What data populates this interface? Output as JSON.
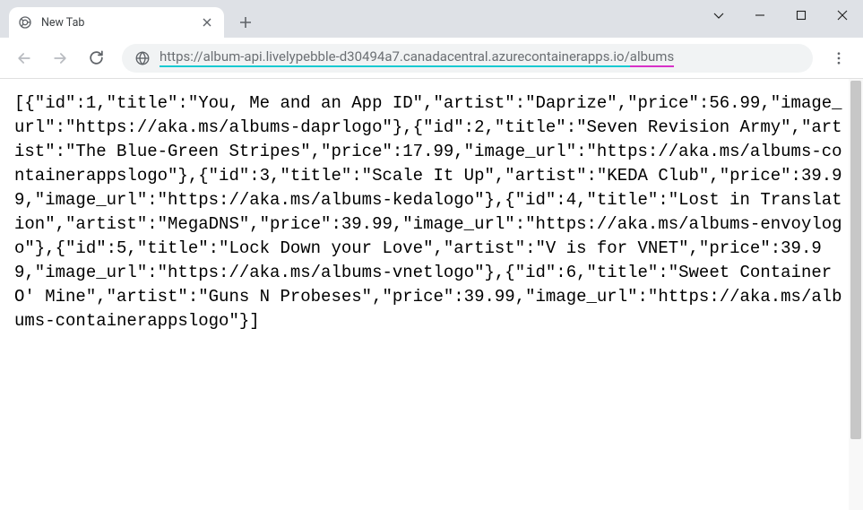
{
  "window": {
    "tab_title": "New Tab"
  },
  "toolbar": {
    "url_main": "https://album-api.livelypebble-d30494a7.canadacentral.azurecontainerapps.io/",
    "url_path": "albums"
  },
  "body_text": "[{\"id\":1,\"title\":\"You, Me and an App ID\",\"artist\":\"Daprize\",\"price\":56.99,\"image_url\":\"https://aka.ms/albums-daprlogo\"},{\"id\":2,\"title\":\"Seven Revision Army\",\"artist\":\"The Blue-Green Stripes\",\"price\":17.99,\"image_url\":\"https://aka.ms/albums-containerappslogo\"},{\"id\":3,\"title\":\"Scale It Up\",\"artist\":\"KEDA Club\",\"price\":39.99,\"image_url\":\"https://aka.ms/albums-kedalogo\"},{\"id\":4,\"title\":\"Lost in Translation\",\"artist\":\"MegaDNS\",\"price\":39.99,\"image_url\":\"https://aka.ms/albums-envoylogo\"},{\"id\":5,\"title\":\"Lock Down your Love\",\"artist\":\"V is for VNET\",\"price\":39.99,\"image_url\":\"https://aka.ms/albums-vnetlogo\"},{\"id\":6,\"title\":\"Sweet Container O' Mine\",\"artist\":\"Guns N Probeses\",\"price\":39.99,\"image_url\":\"https://aka.ms/albums-containerappslogo\"}]"
}
